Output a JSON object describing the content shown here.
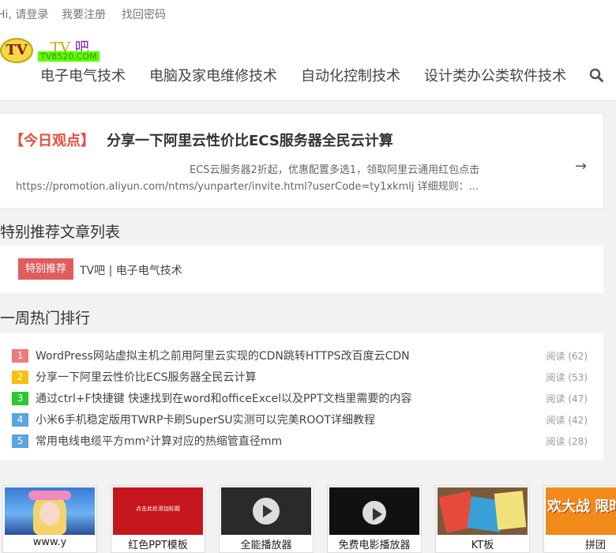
{
  "topbar": {
    "login": "Hi, 请登录",
    "register": "我要注册",
    "recover": "找回密码"
  },
  "logo": {
    "badge": "TV",
    "title_a": "TV",
    "title_b": "吧",
    "url": "TV8520.COM"
  },
  "nav": [
    "电子电气技术",
    "电脑及家电维修技术",
    "自动化控制技术",
    "设计类办公类软件技术"
  ],
  "today": {
    "tag": "【今日观点】",
    "title": "分享一下阿里云性价比ECS服务器全民云计算",
    "desc_line1": "ECS云服务器2折起，优惠配置多选1，领取阿里云通用红包点击",
    "desc_line2": "https://promotion.aliyun.com/ntms/yunparter/invite.html?userCode=ty1xkmlj 详细规则：...",
    "arrow": "→"
  },
  "recommend": {
    "heading": "特别推荐文章列表",
    "tag": "特别推荐",
    "text": "TV吧 | 电子电气技术"
  },
  "hot": {
    "heading": "一周热门排行",
    "items": [
      {
        "rank": "1",
        "title": "WordPress网站虚拟主机之前用阿里云实现的CDN跳转HTTPS改百度云CDN",
        "count": "阅读 (62)",
        "color": "#f07a7a"
      },
      {
        "rank": "2",
        "title": "分享一下阿里云性价比ECS服务器全民云计算",
        "count": "阅读 (53)",
        "color": "#f4c20d"
      },
      {
        "rank": "3",
        "title": "通过ctrl+F快捷键 快速找到在word和officeExcel以及PPT文档里需要的内容",
        "count": "阅读 (47)",
        "color": "#2dc82d"
      },
      {
        "rank": "4",
        "title": "小米6手机稳定版用TWRP卡刷SuperSU实测可以完美ROOT详细教程",
        "count": "阅读 (42)",
        "color": "#5aa5e0"
      },
      {
        "rank": "5",
        "title": "常用电线电缆平方mm²计算对应的热缩管直径mm",
        "count": "阅读 (28)",
        "color": "#5aa5e0"
      }
    ]
  },
  "thumbs": [
    {
      "caption": "www.y"
    },
    {
      "caption": "红色PPT模板",
      "inner_text": "点击此处添加标题"
    },
    {
      "caption": "全能播放器"
    },
    {
      "caption": "免费电影播放器"
    },
    {
      "caption": "KT板"
    },
    {
      "caption": "拼团",
      "inner_text": "欢大战 限时"
    }
  ]
}
